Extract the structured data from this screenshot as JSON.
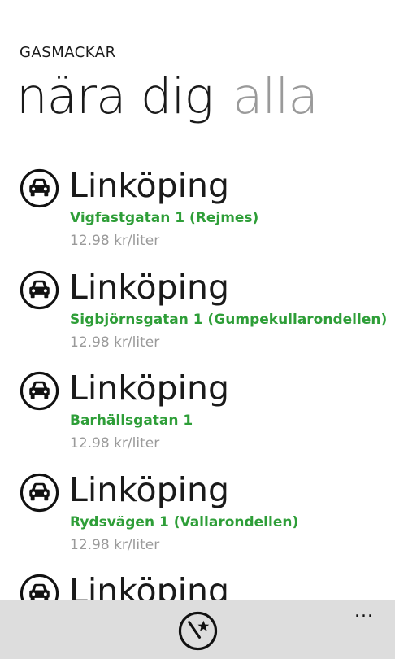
{
  "app": {
    "title": "GASMACKAR"
  },
  "pivot": {
    "items": [
      {
        "label": "nära dig",
        "active": true
      },
      {
        "label": "alla",
        "active": false
      }
    ]
  },
  "stations": [
    {
      "city": "Linköping",
      "address": "Vigfastgatan 1 (Rejmes)",
      "price": "12.98 kr/liter",
      "icon": "car-icon"
    },
    {
      "city": "Linköping",
      "address": "Sigbjörnsgatan 1 (Gumpekullarondellen)",
      "price": "12.98 kr/liter",
      "icon": "car-icon"
    },
    {
      "city": "Linköping",
      "address": "Barhällsgatan 1",
      "price": "12.98 kr/liter",
      "icon": "car-icon"
    },
    {
      "city": "Linköping",
      "address": "Rydsvägen 1 (Vallarondellen)",
      "price": "12.98 kr/liter",
      "icon": "car-icon"
    },
    {
      "city": "Linköping",
      "address": "",
      "price": "",
      "icon": "car-icon"
    }
  ],
  "appbar": {
    "action_icon": "favorite-star-wand-icon",
    "more_label": "..."
  },
  "colors": {
    "accent_green": "#2e9e38",
    "secondary_text": "#9a9a9a",
    "appbar_bg": "#dddddd"
  }
}
